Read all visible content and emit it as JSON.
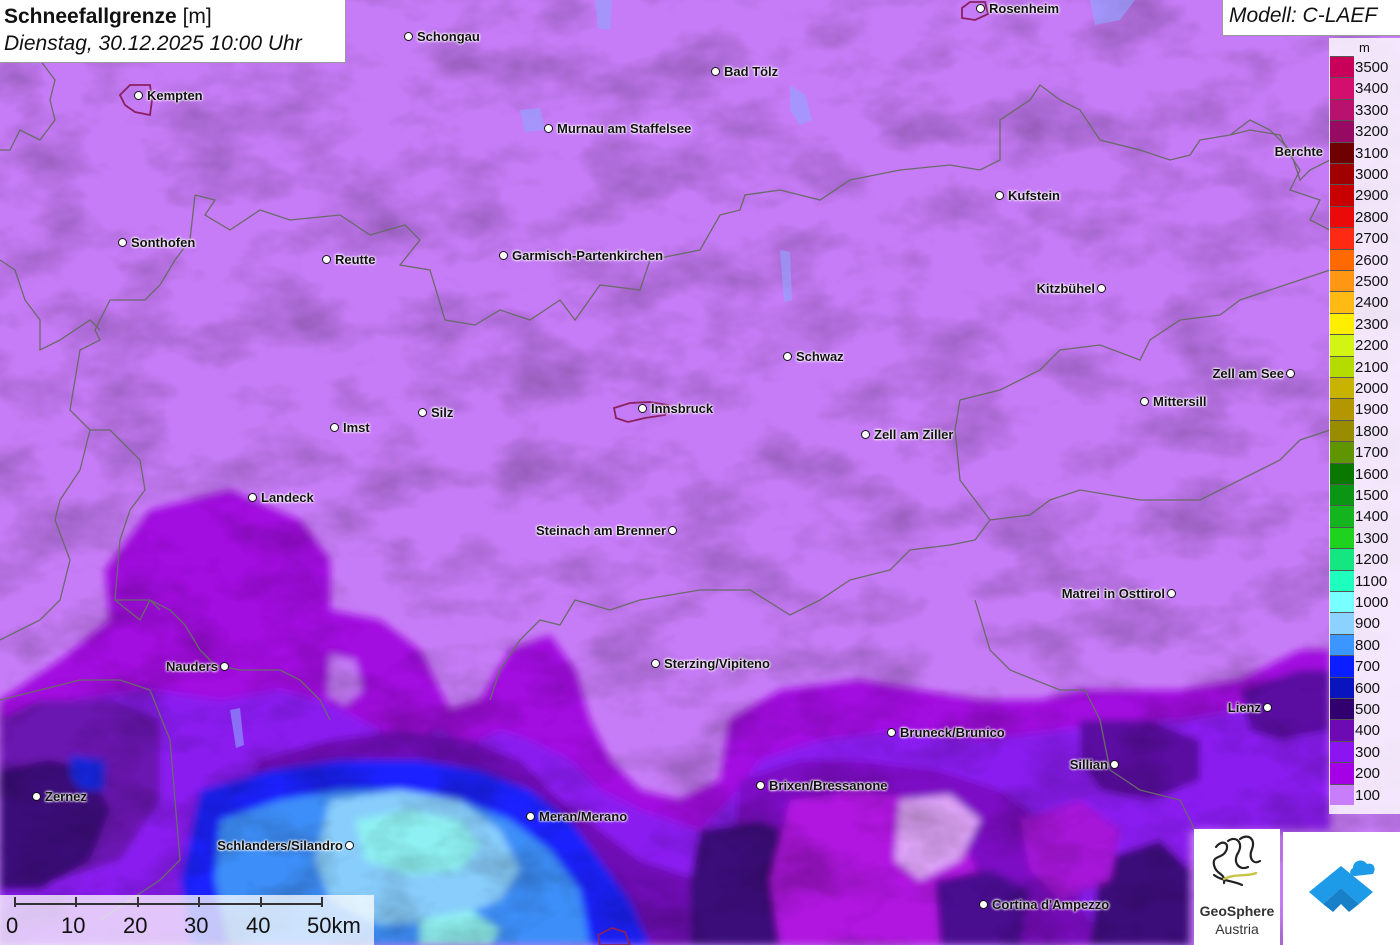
{
  "header": {
    "title_main": "Schneefallgrenze",
    "title_unit": "[m]",
    "datetime": "Dienstag, 30.12.2025 10:00 Uhr",
    "model": "Modell: C-LAEF"
  },
  "legend": {
    "unit": "m",
    "items": [
      {
        "label": "3500",
        "color": "#c8005a"
      },
      {
        "label": "3400",
        "color": "#d20f6e"
      },
      {
        "label": "3300",
        "color": "#b8126e"
      },
      {
        "label": "3200",
        "color": "#960a64"
      },
      {
        "label": "3100",
        "color": "#6e0000"
      },
      {
        "label": "3000",
        "color": "#a00000"
      },
      {
        "label": "2900",
        "color": "#c80000"
      },
      {
        "label": "2800",
        "color": "#ea0a0a"
      },
      {
        "label": "2700",
        "color": "#ff2a14"
      },
      {
        "label": "2600",
        "color": "#ff6a00"
      },
      {
        "label": "2500",
        "color": "#ff9614"
      },
      {
        "label": "2400",
        "color": "#ffbb14"
      },
      {
        "label": "2300",
        "color": "#ffee00"
      },
      {
        "label": "2200",
        "color": "#d2f514"
      },
      {
        "label": "2100",
        "color": "#b4dc00"
      },
      {
        "label": "2000",
        "color": "#c8b400"
      },
      {
        "label": "1900",
        "color": "#b49600"
      },
      {
        "label": "1800",
        "color": "#9a8c00"
      },
      {
        "label": "1700",
        "color": "#5f9600"
      },
      {
        "label": "1600",
        "color": "#0a7800"
      },
      {
        "label": "1500",
        "color": "#0a9614"
      },
      {
        "label": "1400",
        "color": "#14b41e"
      },
      {
        "label": "1300",
        "color": "#1ed21e"
      },
      {
        "label": "1200",
        "color": "#14e682"
      },
      {
        "label": "1100",
        "color": "#1effbe"
      },
      {
        "label": "1000",
        "color": "#78ffff"
      },
      {
        "label": "900",
        "color": "#8cd2ff"
      },
      {
        "label": "800",
        "color": "#3c96ff"
      },
      {
        "label": "700",
        "color": "#0a1eff"
      },
      {
        "label": "600",
        "color": "#0a14be"
      },
      {
        "label": "500",
        "color": "#32006e"
      },
      {
        "label": "400",
        "color": "#6e0ab4"
      },
      {
        "label": "300",
        "color": "#8c14f0"
      },
      {
        "label": "200",
        "color": "#a500e6"
      },
      {
        "label": "100",
        "color": "#c87dfa"
      }
    ]
  },
  "cities": [
    {
      "name": "Rosenheim",
      "label_side": "right"
    },
    {
      "name": "Schongau",
      "label_side": "right"
    },
    {
      "name": "Kempten",
      "label_side": "right"
    },
    {
      "name": "Bad Tölz",
      "label_side": "right"
    },
    {
      "name": "Murnau am Staffelsee",
      "label_side": "right"
    },
    {
      "name": "Berchte",
      "label_side": "left"
    },
    {
      "name": "Kufstein",
      "label_side": "right"
    },
    {
      "name": "Sonthofen",
      "label_side": "right"
    },
    {
      "name": "Reutte",
      "label_side": "right"
    },
    {
      "name": "Garmisch-Partenkirchen",
      "label_side": "right"
    },
    {
      "name": "Kitzbühel",
      "label_side": "left"
    },
    {
      "name": "Schwaz",
      "label_side": "right"
    },
    {
      "name": "Zell am See",
      "label_side": "left"
    },
    {
      "name": "Mittersill",
      "label_side": "right"
    },
    {
      "name": "Innsbruck",
      "label_side": "right"
    },
    {
      "name": "Silz",
      "label_side": "right"
    },
    {
      "name": "Imst",
      "label_side": "right"
    },
    {
      "name": "Zell am Ziller",
      "label_side": "right"
    },
    {
      "name": "Landeck",
      "label_side": "right"
    },
    {
      "name": "Steinach am Brenner",
      "label_side": "left"
    },
    {
      "name": "Matrei in Osttirol",
      "label_side": "left"
    },
    {
      "name": "Nauders",
      "label_side": "left"
    },
    {
      "name": "Sterzing/Vipiteno",
      "label_side": "right"
    },
    {
      "name": "Lienz",
      "label_side": "left"
    },
    {
      "name": "Bruneck/Brunico",
      "label_side": "right"
    },
    {
      "name": "Sillian",
      "label_side": "left"
    },
    {
      "name": "Brixen/Bressanone",
      "label_side": "right"
    },
    {
      "name": "Zernez",
      "label_side": "right"
    },
    {
      "name": "Meran/Merano",
      "label_side": "right"
    },
    {
      "name": "Schlanders/Silandro",
      "label_side": "left"
    },
    {
      "name": "Cortina d'Ampezzo",
      "label_side": "right"
    }
  ],
  "scale": {
    "labels": [
      "0",
      "10",
      "20",
      "30",
      "40",
      "50km"
    ]
  },
  "logos": {
    "geosphere_line1": "GeoSphere",
    "geosphere_line2": "Austria"
  }
}
